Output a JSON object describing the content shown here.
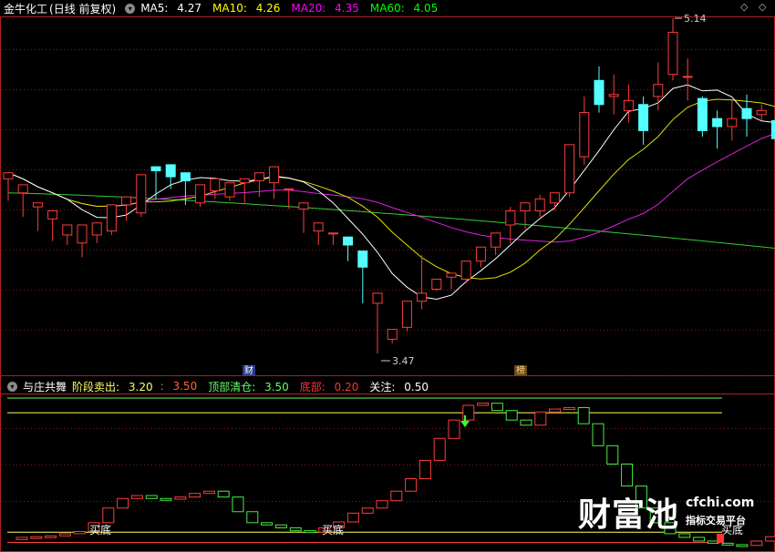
{
  "header": {
    "stock": "金牛化工",
    "mode": "(日线 前复权)",
    "ma": [
      {
        "label": "MA5:",
        "value": "4.27",
        "color": "#ffffff"
      },
      {
        "label": "MA10:",
        "value": "4.26",
        "color": "#ffff00"
      },
      {
        "label": "MA20:",
        "value": "4.35",
        "color": "#ff00ff"
      },
      {
        "label": "MA60:",
        "value": "4.05",
        "color": "#00ff00"
      }
    ],
    "nav_left": "◇",
    "nav_right": "◇"
  },
  "indicator": {
    "name": "与庄共舞",
    "items": [
      {
        "label": "阶段卖出:",
        "value": "3.20",
        "color": "#ffff66"
      },
      {
        "label": ":",
        "value": "3.50",
        "color": "#ff6633"
      },
      {
        "label": "顶部清仓:",
        "value": "3.50",
        "color": "#66ff66"
      },
      {
        "label": "底部:",
        "value": "0.20",
        "color": "#ff3333"
      },
      {
        "label": "关注:",
        "value": "0.50",
        "color": "#ffffff"
      }
    ],
    "signals": [
      "买底",
      "买底",
      "买底"
    ]
  },
  "markers": {
    "high": "5.14",
    "low": "3.47",
    "tag1": "财",
    "tag2": "榜"
  },
  "watermark": {
    "logo": "财富池",
    "site": "cfchi.com",
    "slogan": "指标交易平台"
  },
  "chart_data": {
    "type": "candlestick",
    "up_color": "#ff3c3c",
    "down_color": "#54ffff",
    "candles": [
      [
        4.34,
        4.37,
        4.25,
        4.23
      ],
      [
        4.27,
        4.31,
        4.17,
        4.15
      ],
      [
        4.2,
        4.22,
        4.1,
        4.08
      ],
      [
        4.14,
        4.18,
        4.05,
        4.03
      ],
      [
        4.06,
        4.11,
        4.03,
        4.01
      ],
      [
        4.02,
        4.11,
        3.98,
        3.95
      ],
      [
        4.06,
        4.12,
        4.04,
        4.02
      ],
      [
        4.08,
        4.21,
        4.1,
        4.06
      ],
      [
        4.21,
        4.25,
        4.15,
        4.13
      ],
      [
        4.17,
        4.36,
        4.23,
        4.15
      ],
      [
        4.4,
        4.38,
        4.3,
        4.24
      ],
      [
        4.41,
        4.35,
        4.31,
        4.29
      ],
      [
        4.37,
        4.33,
        4.23,
        4.21
      ],
      [
        4.22,
        4.31,
        4.27,
        4.2
      ],
      [
        4.28,
        4.34,
        4.25,
        4.24
      ],
      [
        4.25,
        4.32,
        4.26,
        4.23
      ],
      [
        4.32,
        4.34,
        4.26,
        4.22
      ],
      [
        4.33,
        4.37,
        4.32,
        4.25
      ],
      [
        4.32,
        4.4,
        4.32,
        4.24
      ],
      [
        4.29,
        4.29,
        4.21,
        4.19
      ],
      [
        4.19,
        4.22,
        4.09,
        4.07
      ],
      [
        4.08,
        4.12,
        4.03,
        4.01
      ],
      [
        4.07,
        4.07,
        4.03,
        4.01
      ],
      [
        4.05,
        4.01,
        3.96,
        3.93
      ],
      [
        3.98,
        3.9,
        3.75,
        3.72
      ],
      [
        3.72,
        3.77,
        3.5,
        3.47
      ],
      [
        3.54,
        3.59,
        3.55,
        3.52
      ],
      [
        3.6,
        3.73,
        3.66,
        3.58
      ],
      [
        3.73,
        3.77,
        3.96,
        3.69
      ],
      [
        3.79,
        3.84,
        3.81,
        3.78
      ],
      [
        3.85,
        3.87,
        3.82,
        3.79
      ],
      [
        3.84,
        3.93,
        3.89,
        3.82
      ],
      [
        3.93,
        4.0,
        3.97,
        3.9
      ],
      [
        4.0,
        4.07,
        4.04,
        3.96
      ],
      [
        4.11,
        4.18,
        4.2,
        4.02
      ],
      [
        4.18,
        4.22,
        4.15,
        4.09
      ],
      [
        4.18,
        4.24,
        4.26,
        4.15
      ],
      [
        4.22,
        4.27,
        4.26,
        4.18
      ],
      [
        4.27,
        4.51,
        4.51,
        4.25
      ],
      [
        4.45,
        4.67,
        4.75,
        4.41
      ],
      [
        4.83,
        4.71,
        4.9,
        4.67
      ],
      [
        4.75,
        4.76,
        4.86,
        4.66
      ],
      [
        4.68,
        4.73,
        4.81,
        4.62
      ],
      [
        4.71,
        4.58,
        4.75,
        4.51
      ],
      [
        4.75,
        4.81,
        4.92,
        4.68
      ],
      [
        4.86,
        5.07,
        5.14,
        4.83
      ],
      [
        4.85,
        4.85,
        4.94,
        4.73
      ],
      [
        4.74,
        4.58,
        4.75,
        4.55
      ],
      [
        4.64,
        4.6,
        4.68,
        4.49
      ],
      [
        4.6,
        4.64,
        4.73,
        4.53
      ],
      [
        4.69,
        4.64,
        4.76,
        4.55
      ],
      [
        4.66,
        4.68,
        4.71,
        4.63
      ],
      [
        4.63,
        4.54,
        4.7,
        4.49
      ],
      [
        4.56,
        4.55,
        4.62,
        4.46
      ],
      [
        4.61,
        4.66,
        4.69,
        4.58
      ],
      [
        4.58,
        4.63,
        4.61,
        4.52
      ],
      [
        4.56,
        4.51,
        4.58,
        4.49
      ],
      [
        4.52,
        4.52,
        4.49,
        4.47
      ],
      [
        4.56,
        4.68,
        4.7,
        4.52
      ],
      [
        4.62,
        4.9,
        4.75,
        4.59
      ],
      [
        4.76,
        4.98,
        5.08,
        4.72
      ]
    ],
    "ma_series": [
      "MA5",
      "MA10",
      "MA20",
      "MA60"
    ],
    "sub_candles": [
      [
        0.02,
        0.05,
        0.08,
        0.0
      ],
      [
        0.05,
        0.06,
        0.07,
        0.03
      ],
      [
        0.06,
        0.07,
        0.09,
        0.05
      ],
      [
        0.07,
        0.1,
        0.12,
        0.06
      ],
      [
        0.1,
        0.13,
        0.15,
        0.08
      ],
      [
        0.13,
        0.25,
        0.27,
        0.11
      ],
      [
        0.25,
        0.45,
        0.47,
        0.23
      ],
      [
        0.45,
        0.58,
        0.6,
        0.43
      ],
      [
        0.58,
        0.62,
        0.64,
        0.56
      ],
      [
        0.62,
        0.58,
        0.63,
        0.56
      ],
      [
        0.58,
        0.57,
        0.6,
        0.55
      ],
      [
        0.57,
        0.6,
        0.62,
        0.55
      ],
      [
        0.6,
        0.65,
        0.67,
        0.58
      ],
      [
        0.65,
        0.68,
        0.7,
        0.63
      ],
      [
        0.68,
        0.6,
        0.7,
        0.58
      ],
      [
        0.6,
        0.4,
        0.62,
        0.38
      ],
      [
        0.4,
        0.25,
        0.42,
        0.23
      ],
      [
        0.25,
        0.22,
        0.27,
        0.2
      ],
      [
        0.22,
        0.18,
        0.24,
        0.16
      ],
      [
        0.18,
        0.14,
        0.2,
        0.12
      ],
      [
        0.14,
        0.12,
        0.16,
        0.1
      ],
      [
        0.12,
        0.18,
        0.2,
        0.1
      ],
      [
        0.18,
        0.26,
        0.28,
        0.16
      ],
      [
        0.26,
        0.38,
        0.4,
        0.24
      ],
      [
        0.38,
        0.45,
        0.47,
        0.36
      ],
      [
        0.45,
        0.55,
        0.57,
        0.43
      ],
      [
        0.55,
        0.68,
        0.7,
        0.53
      ],
      [
        0.68,
        0.85,
        0.87,
        0.66
      ],
      [
        0.85,
        1.1,
        1.12,
        0.83
      ],
      [
        1.1,
        1.4,
        1.42,
        1.08
      ],
      [
        1.4,
        1.65,
        1.67,
        1.38
      ],
      [
        1.65,
        1.85,
        1.87,
        1.63
      ],
      [
        1.85,
        1.88,
        1.9,
        1.83
      ],
      [
        1.88,
        1.78,
        1.9,
        1.76
      ],
      [
        1.78,
        1.65,
        1.8,
        1.63
      ],
      [
        1.65,
        1.58,
        1.67,
        1.56
      ],
      [
        1.58,
        1.76,
        1.78,
        1.56
      ],
      [
        1.76,
        1.8,
        1.82,
        1.74
      ],
      [
        1.8,
        1.82,
        1.84,
        1.78
      ],
      [
        1.82,
        1.6,
        1.84,
        1.58
      ],
      [
        1.6,
        1.3,
        1.62,
        1.28
      ],
      [
        1.3,
        1.05,
        1.32,
        1.03
      ],
      [
        1.05,
        0.75,
        1.07,
        0.73
      ],
      [
        0.75,
        0.45,
        0.77,
        0.43
      ],
      [
        0.45,
        0.25,
        0.47,
        0.23
      ],
      [
        0.25,
        0.1,
        0.27,
        0.08
      ],
      [
        0.1,
        0.05,
        0.12,
        0.03
      ],
      [
        0.05,
        0.0,
        0.07,
        -0.02
      ],
      [
        0.0,
        -0.03,
        0.02,
        -0.05
      ],
      [
        -0.03,
        -0.05,
        -0.01,
        -0.06
      ],
      [
        -0.05,
        -0.06,
        -0.04,
        -0.07
      ],
      [
        -0.06,
        0.0,
        0.02,
        -0.07
      ],
      [
        0.0,
        0.06,
        0.08,
        -0.02
      ]
    ]
  }
}
